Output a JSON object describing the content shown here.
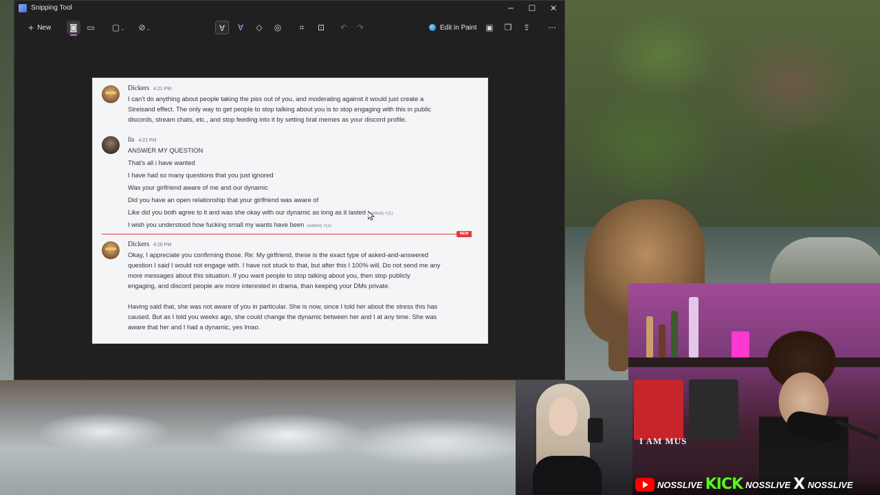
{
  "window": {
    "title": "Snipping Tool",
    "controls": {
      "minimize": "─",
      "maximize": "☐",
      "close": "✕"
    }
  },
  "toolbar": {
    "new_label": "New",
    "edit_in_paint_label": "Edit in Paint",
    "icons": [
      "screenshot-mode-icon",
      "video-mode-icon",
      "rectangle-mode-icon",
      "delay-icon",
      "ballpoint-pen-icon",
      "highlighter-icon",
      "eraser-icon",
      "shapes-icon",
      "crop-icon",
      "text-actions-icon",
      "undo-icon",
      "redo-icon",
      "paint-icon",
      "save-icon",
      "copy-icon",
      "share-icon",
      "more-icon"
    ]
  },
  "chat": {
    "messages": [
      {
        "user": "Dickers",
        "time": "4:21 PM",
        "lines": [
          "I can't do anything about people taking the piss out of you, and moderating against it would just create a",
          "Streisand effect. The only way to get people to stop talking about you is to stop engaging with this in public",
          "discords, stream chats, etc., and stop feeding into it by setting brat memes as your discord profile."
        ]
      },
      {
        "user": "lis",
        "time": "4:21 PM",
        "lines": [
          "ANSWER MY QUESTION",
          "That's all i have wanted",
          "I have had so many questions that you just ignored",
          "Was your girlfriend aware of me and our dynamic",
          "Did you have an open relationship that your girlfriend was aware of",
          "Like did you both agree to it and was she okay with our dynamic as long as it lasted",
          "I wish you understood how fucking small my wants have been"
        ],
        "edited_tag": "(edited) <(1)"
      },
      {
        "user": "Dickers",
        "time": "4:26 PM",
        "lines": [
          "Okay, I appreciate you confirming those. Re: My girlfriend, these is the exact type of asked-and-answered",
          "question I said I would not engage with. I have not stuck to that, but after this I 100% will. Do not send me any",
          "more messages about this situation. If you want people to stop talking about you, then stop publicly",
          "engaging, and discord people are more interested in drama, than keeping your DMs private.",
          "",
          "Having said that, she was not aware of you in particular. She is now, since I told her about the stress this has",
          "caused. But as I told you weeks ago, she could change the dynamic between her and I at any time. She was",
          "aware that her and I had a dynamic, yes lmao."
        ]
      }
    ],
    "new_badge": "NEW"
  },
  "webcam": {
    "sign_text": "I AM MUS"
  },
  "social": {
    "youtube_handle": "NOSSLIVE",
    "kick_logo": "KICK",
    "kick_handle": "NOSSLIVE",
    "x_logo": "X",
    "x_handle": "NOSSLIVE"
  },
  "colors": {
    "accent_pink": "#d16bd8",
    "new_red": "#e2393f",
    "kick_green": "#53fc18",
    "youtube_red": "#ff0000"
  }
}
